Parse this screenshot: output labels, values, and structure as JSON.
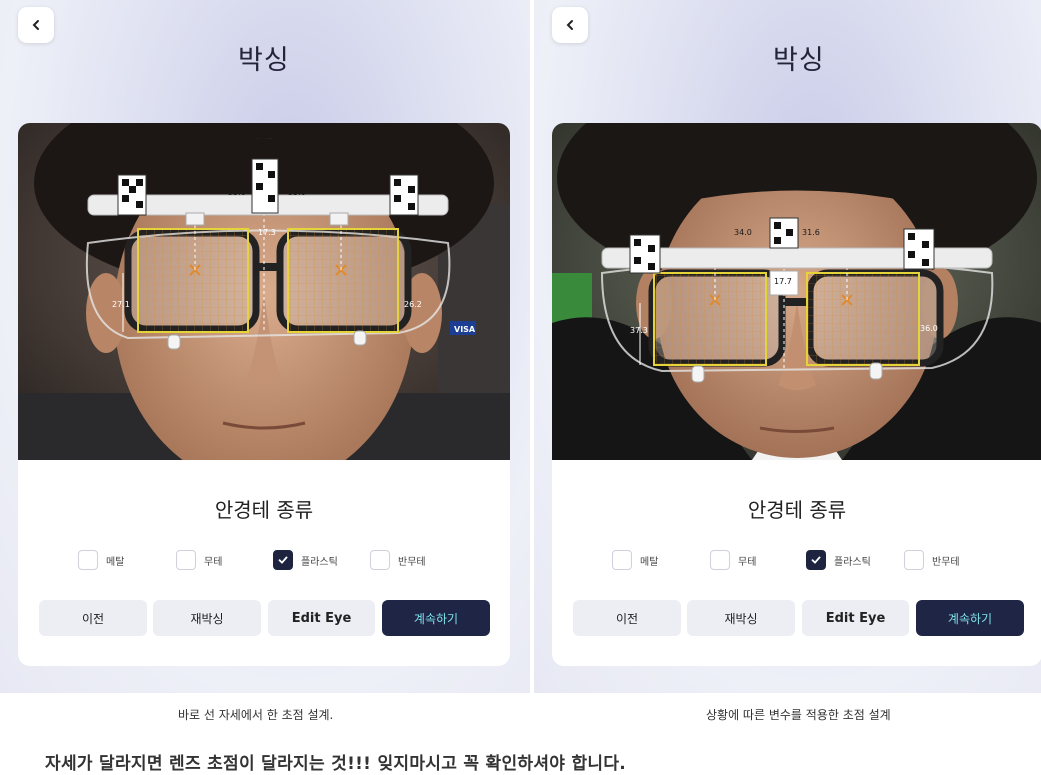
{
  "left": {
    "title": "박싱",
    "measurements": {
      "pd_left": "33.0",
      "pd_right": "33.0",
      "bridge": "17.3",
      "height_left": "27.1",
      "height_right": "26.2"
    },
    "card_title": "안경테 종류",
    "options": [
      {
        "label": "메탈",
        "checked": false
      },
      {
        "label": "무테",
        "checked": false
      },
      {
        "label": "플라스틱",
        "checked": true
      },
      {
        "label": "반무테",
        "checked": false
      }
    ],
    "buttons": {
      "prev": "이전",
      "rebox": "재박싱",
      "edit": "Edit Eye",
      "next": "계속하기"
    },
    "caption": "바로 선 자세에서 한 초점 설계."
  },
  "right": {
    "title": "박싱",
    "measurements": {
      "pd_left": "34.0",
      "pd_right": "31.6",
      "bridge": "17.7",
      "height_left": "37.3",
      "height_right": "36.0"
    },
    "card_title": "안경테 종류",
    "options": [
      {
        "label": "메탈",
        "checked": false
      },
      {
        "label": "무테",
        "checked": false
      },
      {
        "label": "플라스틱",
        "checked": true
      },
      {
        "label": "반무테",
        "checked": false
      }
    ],
    "buttons": {
      "prev": "이전",
      "rebox": "재박싱",
      "edit": "Edit Eye",
      "next": "계속하기"
    },
    "caption": "상황에 따른 변수를 적용한 초점 설계"
  },
  "footnote": "자세가 달라지면 렌즈 초점이 달라지는 것!!! 잊지마시고 꼭 확인하셔야 합니다.",
  "visa_badge": "VISA",
  "colors": {
    "dark_button": "#1f2545",
    "dark_button_text": "#7fe2ea",
    "frame_box": "#e5d33a",
    "grid": "#e08a2b"
  }
}
